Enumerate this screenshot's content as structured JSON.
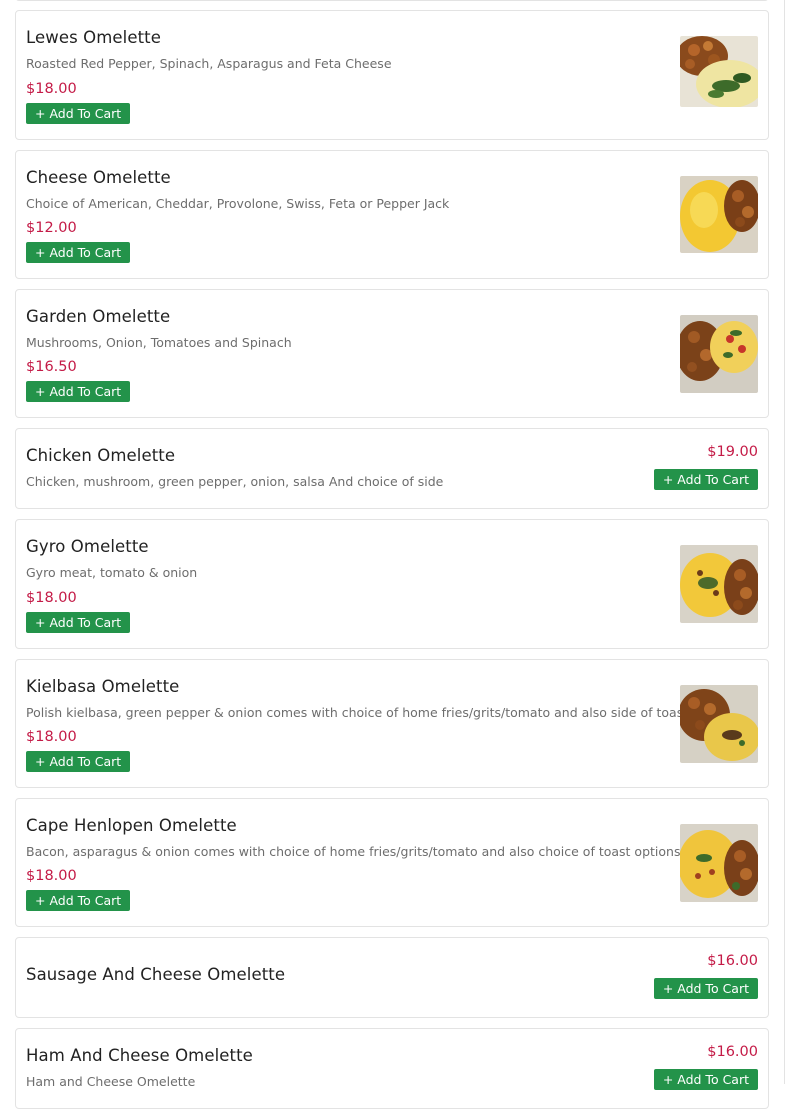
{
  "add_label": "+ Add To Cart",
  "items": [
    {
      "name": "Lewes Omelette",
      "desc": "Roasted Red Pepper, Spinach, Asparagus and Feta Cheese",
      "price": "$18.00",
      "image": "omelette-spinach-photo"
    },
    {
      "name": "Cheese Omelette",
      "desc": "Choice of American, Cheddar, Provolone, Swiss, Feta or Pepper Jack",
      "price": "$12.00",
      "image": "omelette-cheese-photo"
    },
    {
      "name": "Garden Omelette",
      "desc": "Mushrooms, Onion, Tomatoes and Spinach",
      "price": "$16.50",
      "image": "omelette-garden-photo"
    },
    {
      "name": "Chicken Omelette",
      "desc": "Chicken, mushroom, green pepper, onion, salsa And choice of side",
      "price": "$19.00",
      "image": ""
    },
    {
      "name": "Gyro Omelette",
      "desc": "Gyro meat, tomato & onion",
      "price": "$18.00",
      "image": "omelette-gyro-photo"
    },
    {
      "name": "Kielbasa Omelette",
      "desc": "Polish kielbasa, green pepper & onion comes with choice of home fries/grits/tomato and also side of toast",
      "price": "$18.00",
      "image": "omelette-kielbasa-photo"
    },
    {
      "name": "Cape Henlopen Omelette",
      "desc": "Bacon, asparagus & onion comes with choice of home fries/grits/tomato and also choice of toast options",
      "price": "$18.00",
      "image": "omelette-cape-henlopen-photo"
    },
    {
      "name": "Sausage And Cheese Omelette",
      "desc": "",
      "price": "$16.00",
      "image": ""
    },
    {
      "name": "Ham And Cheese Omelette",
      "desc": "Ham and Cheese Omelette",
      "price": "$16.00",
      "image": ""
    }
  ],
  "colors": {
    "price": "#c41b47",
    "button": "#23934a",
    "border": "#e3e3e3"
  }
}
